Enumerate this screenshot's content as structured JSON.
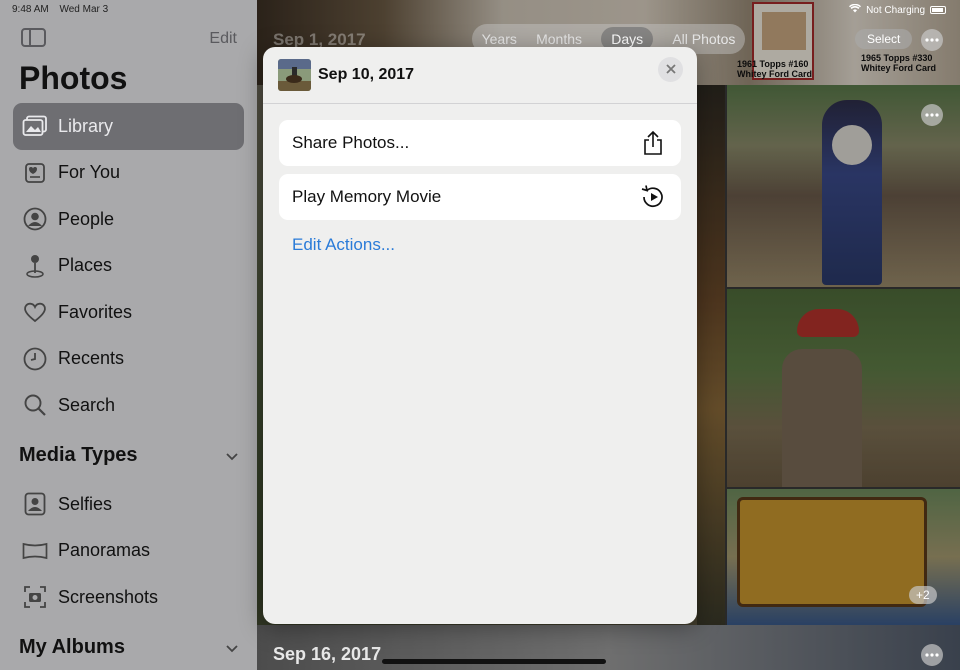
{
  "status_bar": {
    "time": "9:48 AM",
    "date": "Wed Mar 3",
    "battery_text": "Not Charging"
  },
  "sidebar": {
    "edit_label": "Edit",
    "title": "Photos",
    "items": [
      {
        "label": "Library",
        "icon": "photo-library-icon",
        "active": true
      },
      {
        "label": "For You",
        "icon": "for-you-icon"
      },
      {
        "label": "People",
        "icon": "person-icon"
      },
      {
        "label": "Places",
        "icon": "map-pin-icon"
      },
      {
        "label": "Favorites",
        "icon": "heart-icon"
      },
      {
        "label": "Recents",
        "icon": "clock-icon"
      },
      {
        "label": "Search",
        "icon": "search-icon"
      }
    ],
    "media_types": {
      "heading": "Media Types",
      "items": [
        {
          "label": "Selfies",
          "icon": "selfie-icon"
        },
        {
          "label": "Panoramas",
          "icon": "panorama-icon"
        },
        {
          "label": "Screenshots",
          "icon": "screenshot-icon"
        }
      ]
    },
    "my_albums": {
      "heading": "My Albums"
    }
  },
  "library": {
    "segments": [
      "Years",
      "Months",
      "Days",
      "All Photos"
    ],
    "active_segment": "Days",
    "select_label": "Select",
    "date_top": "Sep 1, 2017",
    "date_bottom": "Sep 16, 2017",
    "more_count": "+2",
    "card_1": "1961 Topps #160\nWhitey Ford Card",
    "card_2": "1965 Topps #330\nWhitey Ford Card"
  },
  "popover": {
    "title": "Sep 10, 2017",
    "actions": [
      {
        "label": "Share Photos...",
        "icon": "share-icon"
      },
      {
        "label": "Play Memory Movie",
        "icon": "play-memory-icon"
      }
    ],
    "edit_actions_label": "Edit Actions..."
  },
  "colors": {
    "accent": "#2a7bd8",
    "sidebar_bg": "#a9a9ab",
    "active_item": "#6e6e72"
  }
}
